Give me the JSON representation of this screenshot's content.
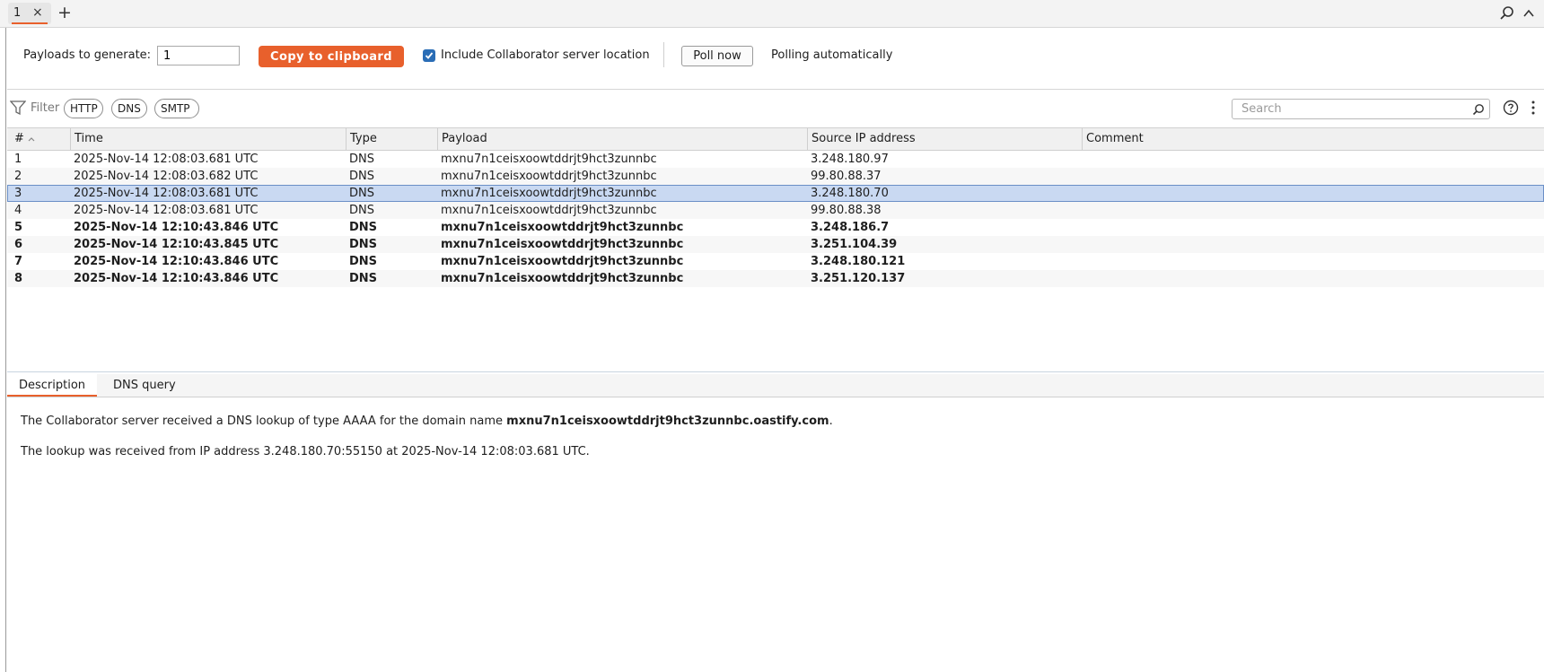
{
  "tabs": [
    {
      "label": "1",
      "close": "×"
    }
  ],
  "tab_add": "+",
  "toolbar": {
    "payloads_label": "Payloads to generate:",
    "payloads_value": "1",
    "copy_label": "Copy to clipboard",
    "include_label": "Include Collaborator server location",
    "include_checked": true,
    "poll_label": "Poll now",
    "poll_status": "Polling automatically"
  },
  "filter": {
    "label": "Filter",
    "chips": [
      "HTTP",
      "DNS",
      "SMTP"
    ],
    "search_placeholder": "Search"
  },
  "table": {
    "columns": [
      "#",
      "Time",
      "Type",
      "Payload",
      "Source IP address",
      "Comment"
    ],
    "selected_row": 3,
    "rows": [
      {
        "num": "1",
        "time": "2025-Nov-14 12:08:03.681 UTC",
        "type": "DNS",
        "payload": "mxnu7n1ceisxoowtddrjt9hct3zunnbc",
        "ip": "3.248.180.97",
        "comment": "",
        "bold": false
      },
      {
        "num": "2",
        "time": "2025-Nov-14 12:08:03.682 UTC",
        "type": "DNS",
        "payload": "mxnu7n1ceisxoowtddrjt9hct3zunnbc",
        "ip": "99.80.88.37",
        "comment": "",
        "bold": false
      },
      {
        "num": "3",
        "time": "2025-Nov-14 12:08:03.681 UTC",
        "type": "DNS",
        "payload": "mxnu7n1ceisxoowtddrjt9hct3zunnbc",
        "ip": "3.248.180.70",
        "comment": "",
        "bold": false
      },
      {
        "num": "4",
        "time": "2025-Nov-14 12:08:03.681 UTC",
        "type": "DNS",
        "payload": "mxnu7n1ceisxoowtddrjt9hct3zunnbc",
        "ip": "99.80.88.38",
        "comment": "",
        "bold": false
      },
      {
        "num": "5",
        "time": "2025-Nov-14 12:10:43.846 UTC",
        "type": "DNS",
        "payload": "mxnu7n1ceisxoowtddrjt9hct3zunnbc",
        "ip": "3.248.186.7",
        "comment": "",
        "bold": true
      },
      {
        "num": "6",
        "time": "2025-Nov-14 12:10:43.845 UTC",
        "type": "DNS",
        "payload": "mxnu7n1ceisxoowtddrjt9hct3zunnbc",
        "ip": "3.251.104.39",
        "comment": "",
        "bold": true
      },
      {
        "num": "7",
        "time": "2025-Nov-14 12:10:43.846 UTC",
        "type": "DNS",
        "payload": "mxnu7n1ceisxoowtddrjt9hct3zunnbc",
        "ip": "3.248.180.121",
        "comment": "",
        "bold": true
      },
      {
        "num": "8",
        "time": "2025-Nov-14 12:10:43.846 UTC",
        "type": "DNS",
        "payload": "mxnu7n1ceisxoowtddrjt9hct3zunnbc",
        "ip": "3.251.120.137",
        "comment": "",
        "bold": true
      }
    ]
  },
  "detail": {
    "tabs": [
      "Description",
      "DNS query"
    ],
    "line1_pre": "The Collaborator server received a DNS lookup of type AAAA for the domain name ",
    "line1_domain": "mxnu7n1ceisxoowtddrjt9hct3zunnbc.oastify.com",
    "line1_post": ".",
    "line2": "The lookup was received from IP address 3.248.180.70:55150 at 2025-Nov-14 12:08:03.681 UTC."
  },
  "colors": {
    "accent": "#e8602c",
    "selection": "#c9d9f2",
    "checkbox": "#2a6db6"
  },
  "icons": [
    "close-icon",
    "plus-icon",
    "search-icon",
    "chevron-up-icon",
    "check-icon",
    "filter-icon",
    "help-icon",
    "more-vertical-icon",
    "sort-ascending-icon"
  ]
}
